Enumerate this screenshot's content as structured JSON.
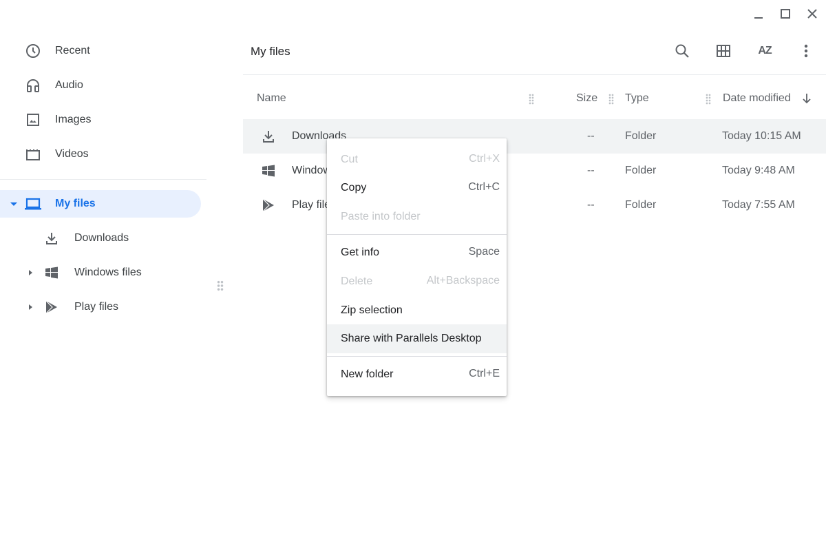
{
  "window": {
    "controls": [
      "minimize",
      "maximize",
      "close"
    ]
  },
  "sidebar": {
    "items": [
      {
        "label": "Recent",
        "icon": "clock-icon"
      },
      {
        "label": "Audio",
        "icon": "headphones-icon"
      },
      {
        "label": "Images",
        "icon": "image-icon"
      },
      {
        "label": "Videos",
        "icon": "film-icon"
      },
      {
        "label": "My files",
        "icon": "laptop-icon",
        "selected": true,
        "expanded": true
      },
      {
        "label": "Downloads",
        "icon": "download-icon"
      },
      {
        "label": "Windows files",
        "icon": "windows-icon"
      },
      {
        "label": "Play files",
        "icon": "play-store-icon"
      }
    ]
  },
  "header": {
    "title": "My files"
  },
  "columns": {
    "name": "Name",
    "size": "Size",
    "type": "Type",
    "date": "Date modified"
  },
  "files": [
    {
      "name": "Downloads",
      "size": "--",
      "type": "Folder",
      "date": "Today 10:15 AM",
      "icon": "download-icon"
    },
    {
      "name": "Windows files",
      "size": "--",
      "type": "Folder",
      "date": "Today 9:48 AM",
      "icon": "windows-icon"
    },
    {
      "name": "Play files",
      "size": "--",
      "type": "Folder",
      "date": "Today 7:55 AM",
      "icon": "play-store-icon"
    }
  ],
  "context_menu": [
    {
      "label": "Cut",
      "shortcut": "Ctrl+X",
      "disabled": true
    },
    {
      "label": "Copy",
      "shortcut": "Ctrl+C"
    },
    {
      "label": "Paste into folder",
      "shortcut": "",
      "disabled": true
    },
    {
      "label": "Get info",
      "shortcut": "Space"
    },
    {
      "label": "Delete",
      "shortcut": "Alt+Backspace",
      "disabled": true
    },
    {
      "label": "Zip selection",
      "shortcut": ""
    },
    {
      "label": "Share with Parallels Desktop",
      "shortcut": "",
      "hovered": true
    },
    {
      "label": "New folder",
      "shortcut": "Ctrl+E"
    }
  ],
  "colors": {
    "accent": "#1a73e8",
    "selected_bg": "#e8f0fe",
    "row_selected": "#f1f3f4"
  }
}
